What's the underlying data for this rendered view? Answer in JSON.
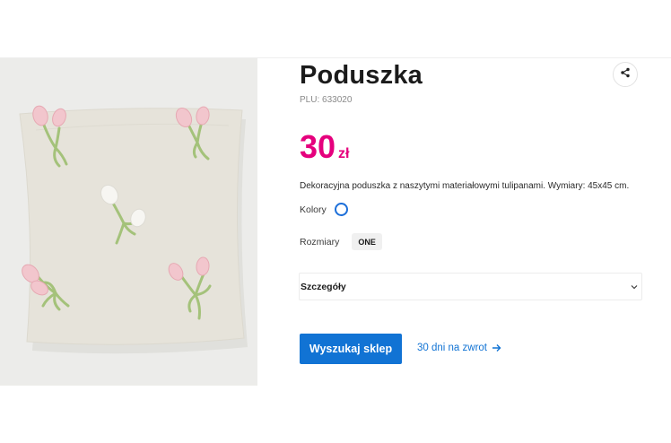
{
  "product": {
    "title": "Poduszka",
    "plu": "PLU: 633020",
    "price_amount": "30",
    "price_currency": "zł",
    "description": "Dekoracyjna poduszka z naszytymi materiałowymi tulipanami. Wymiary: 45x45 cm."
  },
  "options": {
    "colors_label": "Kolory",
    "sizes_label": "Rozmiary",
    "selected_size": "ONE",
    "selected_color": "#ffffff"
  },
  "details": {
    "label": "Szczegóły"
  },
  "actions": {
    "search_store_label": "Wyszukaj sklep",
    "return_label": "30 dni na zwrot"
  },
  "colors": {
    "price": "#e5007d",
    "primary": "#1173d4",
    "swatch_border": "#1d6fd9"
  },
  "icons": {
    "share": "share-icon",
    "chevron": "chevron-down-icon",
    "arrow": "arrow-right-icon"
  }
}
